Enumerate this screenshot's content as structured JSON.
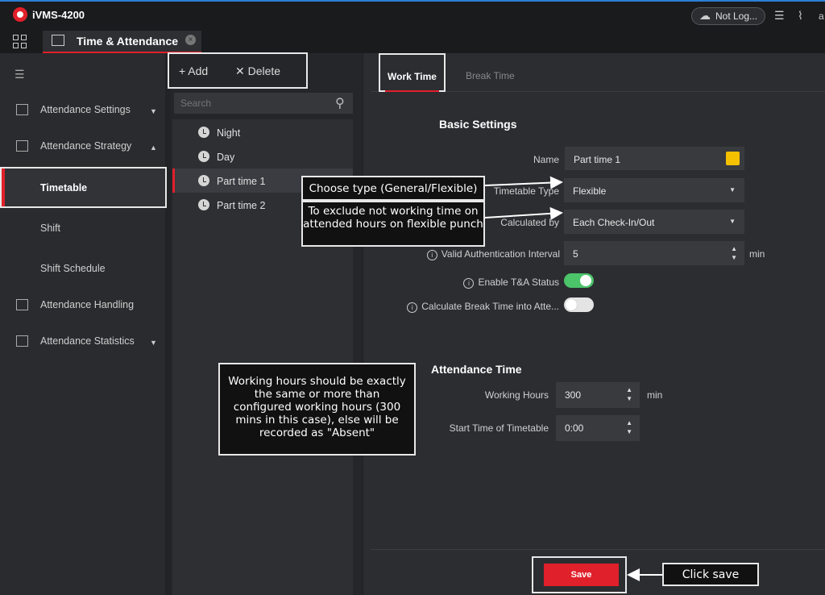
{
  "app": {
    "title": "iVMS-4200",
    "account": "Not Log...",
    "edge_char": "a"
  },
  "tab": {
    "label": "Time & Attendance",
    "close": "×"
  },
  "sidebar": {
    "menu_icon": "menu-icon",
    "items": [
      {
        "label": "Attendance Settings",
        "arrow": "▼"
      },
      {
        "label": "Attendance Strategy",
        "arrow": "▲"
      },
      {
        "label": "Timetable"
      },
      {
        "label": "Shift"
      },
      {
        "label": "Shift Schedule"
      },
      {
        "label": "Attendance Handling"
      },
      {
        "label": "Attendance Statistics",
        "arrow": "▼"
      }
    ]
  },
  "list_panel": {
    "add_label": "+ Add",
    "delete_label": "✕ Delete",
    "search_placeholder": "Search",
    "items": [
      "Night",
      "Day",
      "Part time 1",
      "Part time 2"
    ],
    "selected": "Part time 1"
  },
  "tabs": {
    "work_time": "Work Time",
    "break_time": "Break Time"
  },
  "basic_settings": {
    "title": "Basic Settings",
    "name_label": "Name",
    "name_value": "Part time 1",
    "name_color": "#f5c000",
    "timetable_type_label": "Timetable Type",
    "timetable_type_value": "Flexible",
    "calculated_by_label": "Calculated by",
    "calculated_by_value": "Each Check-In/Out",
    "valid_auth_label": "Valid Authentication Interval",
    "valid_auth_value": "5",
    "valid_auth_unit": "min",
    "enable_ta_label": "Enable T&A Status",
    "enable_ta_on": true,
    "break_time_label": "Calculate Break Time into Atte...",
    "break_time_on": false
  },
  "attendance_time": {
    "title": "Attendance Time",
    "working_hours_label": "Working Hours",
    "working_hours_value": "300",
    "working_hours_unit": "min",
    "start_time_label": "Start Time of Timetable",
    "start_time_value": "0:00"
  },
  "save_label": "Save",
  "callouts": {
    "type": "Choose type (General/Flexible)",
    "exclude": "To exclude not working time on attended hours on flexible punch",
    "hours": "Working hours should be exactly the same or more than configured working hours (300 mins in this case), else will be recorded as \"Absent\"",
    "save": "Click save"
  },
  "colors": {
    "accent": "#e0202a",
    "toggle_on": "#4cc46a",
    "background": "#222326"
  }
}
